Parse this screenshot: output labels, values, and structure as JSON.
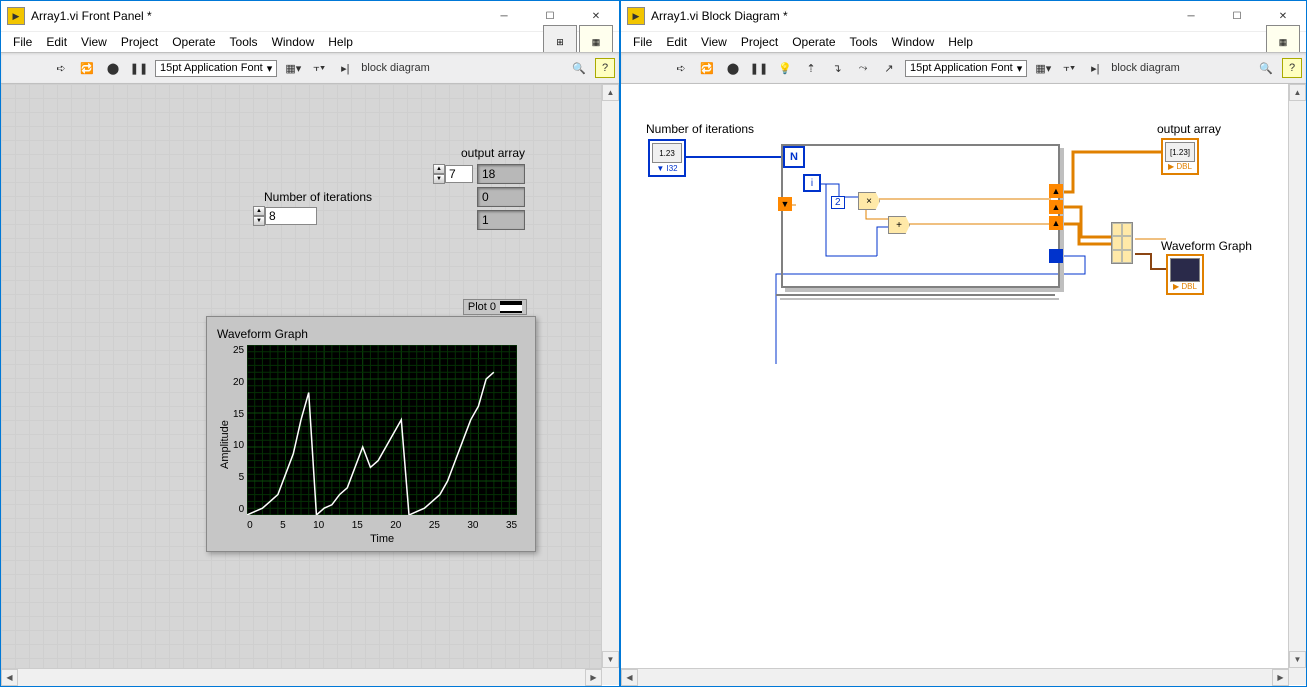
{
  "windows": {
    "front": {
      "title": "Array1.vi Front Panel *",
      "menus": [
        "File",
        "Edit",
        "View",
        "Project",
        "Operate",
        "Tools",
        "Window",
        "Help"
      ],
      "toolbar": {
        "font": "15pt Application Font",
        "crumb": "block diagram"
      },
      "controls": {
        "iterations": {
          "label": "Number of iterations",
          "value": "8"
        },
        "output_array": {
          "label": "output array",
          "index": "7",
          "cells": [
            "18",
            "0",
            "1"
          ]
        },
        "graph": {
          "title": "Waveform Graph",
          "legend": "Plot 0",
          "xlabel": "Time",
          "ylabel": "Amplitude"
        }
      }
    },
    "block": {
      "title": "Array1.vi Block Diagram *",
      "menus": [
        "File",
        "Edit",
        "View",
        "Project",
        "Operate",
        "Tools",
        "Window",
        "Help"
      ],
      "toolbar": {
        "font": "15pt Application Font",
        "crumb": "block diagram"
      },
      "labels": {
        "iterations": "Number of iterations",
        "output_array": "output array",
        "graph": "Waveform Graph",
        "N": "N",
        "i": "i",
        "const2": "2"
      }
    }
  },
  "chart_data": {
    "type": "line",
    "title": "Waveform Graph",
    "xlabel": "Time",
    "ylabel": "Amplitude",
    "x": [
      0,
      1,
      2,
      3,
      4,
      5,
      6,
      7,
      8,
      9,
      10,
      11,
      12,
      13,
      14,
      15,
      16,
      17,
      18,
      19,
      20,
      21,
      22,
      23,
      24,
      25,
      26,
      27,
      28,
      29,
      30,
      31,
      32
    ],
    "values": [
      0,
      0.5,
      1,
      2,
      3,
      6,
      9,
      14,
      18,
      0,
      1,
      1.5,
      3,
      4,
      7,
      10,
      7,
      8,
      10,
      12,
      14,
      0,
      0.5,
      1,
      2,
      3,
      5,
      8,
      11,
      14,
      16,
      20,
      21
    ],
    "xlim": [
      0,
      35
    ],
    "ylim": [
      0,
      25
    ],
    "xticks": [
      0,
      5,
      10,
      15,
      20,
      25,
      30,
      35
    ],
    "yticks": [
      0,
      5,
      10,
      15,
      20,
      25
    ],
    "legend": "Plot 0",
    "color": "#ffffff"
  }
}
